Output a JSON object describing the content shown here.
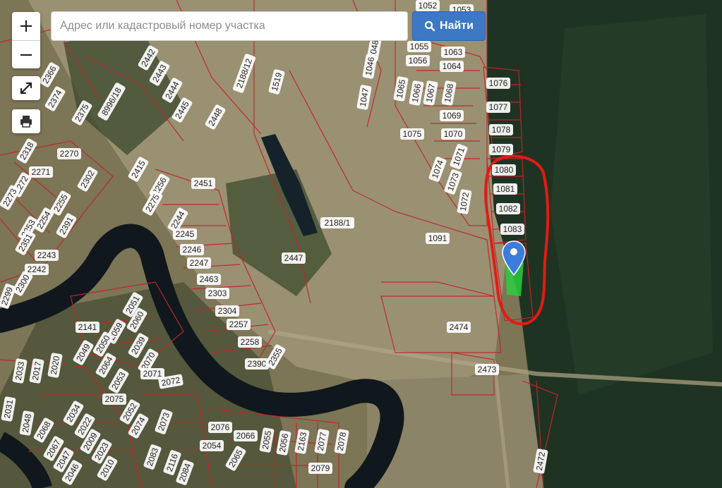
{
  "search": {
    "placeholder": "Адрес или кадастровый номер участка",
    "button_label": "Найти"
  },
  "controls": {
    "zoom_in_label": "+",
    "zoom_out_label": "−"
  },
  "icons": [
    "zoom-in-icon",
    "zoom-out-icon",
    "fullscreen-icon",
    "print-icon",
    "search-icon",
    "map-marker-icon"
  ],
  "colors": {
    "search_button": "#3c78c3",
    "parcel_boundary": "#c0262d",
    "highlight_outline": "#e21b15",
    "selected_parcel": "#2ecc40",
    "marker": "#3b7ddd"
  },
  "parcels": [
    "1052",
    "1053",
    "1055",
    "1063",
    "1056",
    "1064",
    "1048",
    "1046",
    "1047",
    "1065",
    "1066",
    "1067",
    "1068",
    "1076",
    "1077",
    "1069",
    "1070",
    "1078",
    "1075",
    "1079",
    "1071",
    "1074",
    "1073",
    "1072",
    "1080",
    "1081",
    "1082",
    "1083",
    "1091",
    "2188/1",
    "2474",
    "2473",
    "2188/12",
    "1519",
    "2451",
    "2447",
    "2442",
    "2443",
    "2444",
    "2445",
    "2448",
    "8996/18",
    "2366",
    "2374",
    "2375",
    "2318",
    "2270",
    "2271",
    "2272",
    "2273",
    "2255",
    "2254",
    "2253",
    "2391",
    "2302",
    "2415",
    "2256",
    "2275",
    "2244",
    "2245",
    "2246",
    "2247",
    "2463",
    "2303",
    "2304",
    "2257",
    "2258",
    "2390",
    "2355",
    "2351",
    "2243",
    "2242",
    "2300",
    "2299",
    "2051",
    "2060",
    "2141",
    "2059",
    "2050",
    "2049",
    "2039",
    "2070",
    "2064",
    "2071",
    "2053",
    "2072",
    "2075",
    "2052",
    "2034",
    "2074",
    "2022",
    "2009",
    "2073",
    "2068",
    "2067",
    "2023",
    "2047",
    "2010",
    "2046",
    "2116",
    "2083",
    "2084",
    "2076",
    "2066",
    "2054",
    "2065",
    "2055",
    "2056",
    "2163",
    "2077",
    "2078",
    "2079",
    "2472",
    "2031",
    "2048",
    "2033",
    "2017",
    "2020"
  ]
}
